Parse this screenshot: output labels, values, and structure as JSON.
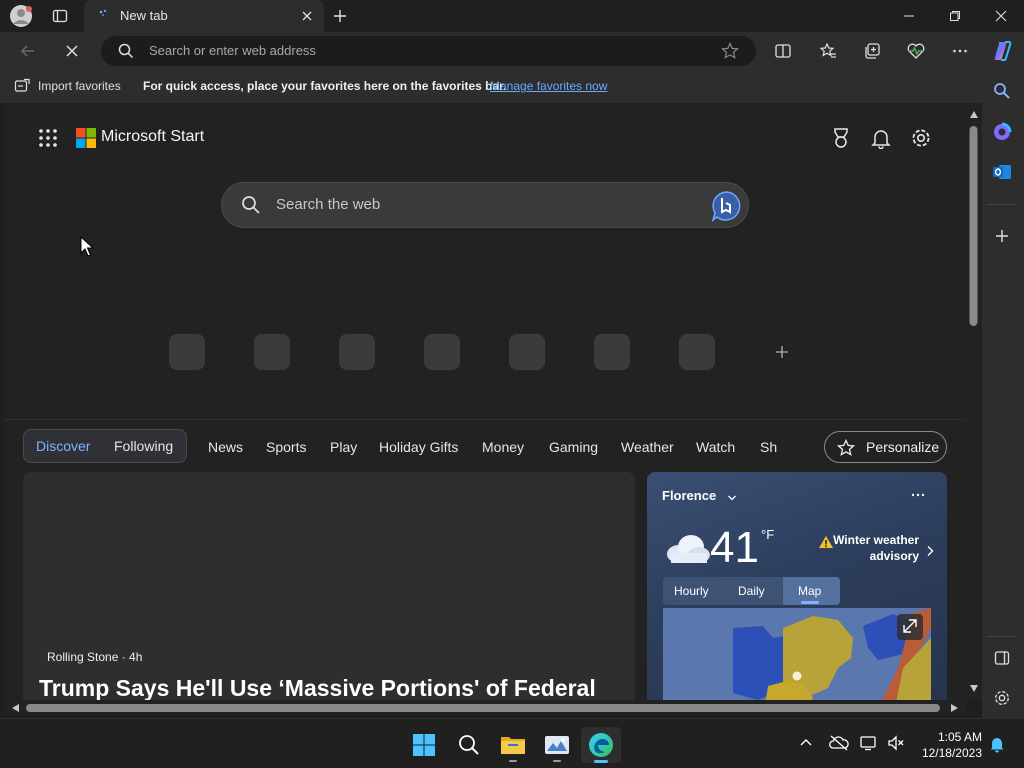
{
  "browser": {
    "tab_title": "New tab",
    "address_placeholder": "Search or enter web address"
  },
  "favorites_bar": {
    "import_label": "Import favorites",
    "hint": "For quick access, place your favorites here on the favorites bar.",
    "manage_link": "Manage favorites now"
  },
  "start_page": {
    "brand": "Microsoft Start",
    "search_placeholder": "Search the web",
    "quick_link_count": 7,
    "feed_tabs": [
      "Discover",
      "Following"
    ],
    "active_feed_tab": "Discover",
    "categories": [
      "News",
      "Sports",
      "Play",
      "Holiday Gifts",
      "Money",
      "Gaming",
      "Weather",
      "Watch",
      "Sh"
    ],
    "personalize_label": "Personalize"
  },
  "news_card": {
    "source": "Rolling Stone · 4h",
    "headline": "Trump Says He'll Use ‘Massive Portions' of Federal"
  },
  "weather": {
    "city": "Florence",
    "temperature": "41",
    "unit": "°F",
    "alert_line1": "Winter weather",
    "alert_line2": "advisory",
    "tabs": [
      "Hourly",
      "Daily",
      "Map"
    ],
    "active_tab": "Map"
  },
  "taskbar": {
    "time": "1:05 AM",
    "date": "12/18/2023"
  },
  "colors": {
    "accent_link": "#6aa9ff",
    "active_tab_text": "#7fb3ff",
    "page_bg": "#222222"
  }
}
